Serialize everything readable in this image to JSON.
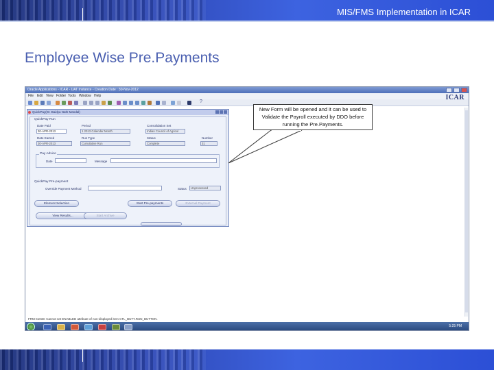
{
  "slide": {
    "header_title": "MIS/FMS Implementation in ICAR",
    "title": "Employee Wise Pre.Payments",
    "callout_text": "New Form will be opened and it can be used to Validate the Payroll executed by DDO before running the Pre.Payments."
  },
  "window": {
    "title": "Oracle Applications - ICAR - UAT Instance - Creation Date : 30-Nov-2012",
    "menu": [
      "File",
      "Edit",
      "View",
      "Folder",
      "Tools",
      "Window",
      "Help"
    ],
    "logo": "ICAR",
    "help_icon": "?"
  },
  "form": {
    "title": "QuickPay(Dr. Baidya Nath Mandal)",
    "quickpay_run_header": "QuickPay Run",
    "date_paid_label": "Date Paid",
    "date_paid_value": "30-APR-2013",
    "period_label": "Period",
    "period_value": "1 2013 Calendar Month",
    "consolidation_set_label": "Consolidation Set",
    "consolidation_set_value": "Indian Council of Agricul",
    "date_earned_label": "Date Earned",
    "date_earned_value": "30-APR-2013",
    "run_type_label": "Run Type",
    "run_type_value": "Cumulative Run",
    "status_label": "Status",
    "status_value": "Complete",
    "number_label": "Number",
    "number_value": "31",
    "pay_advice_header": "Pay Advice",
    "pay_advice_date_label": "Date",
    "pay_advice_message_label": "Message",
    "prepayment_header": "QuickPay Pre-payment",
    "override_label": "Override Payment Method",
    "prepay_status_label": "Status",
    "prepay_status_value": "Unprocessed",
    "buttons": {
      "element_selection": "Element Selection",
      "start_prepayments": "Start Pre-payments",
      "external_payment": "External Payment",
      "view_results": "View Results...",
      "start_archive": "Start Archive"
    }
  },
  "status_message": "FRM-41033: Cannot set ENABLED attribute of non-displayed item CTL_BUTY.RUN_BUTTON.",
  "taskbar": {
    "clock": "5:25 PM"
  }
}
